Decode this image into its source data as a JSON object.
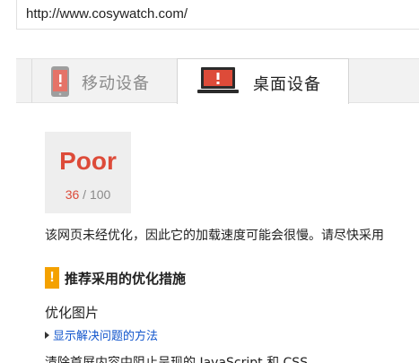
{
  "address_bar": {
    "url": "http://www.cosywatch.com/"
  },
  "tabs": [
    {
      "label": "移动设备",
      "icon": "phone-icon",
      "active": false
    },
    {
      "label": "桌面设备",
      "icon": "laptop-icon",
      "active": true
    }
  ],
  "score": {
    "rating": "Poor",
    "value": "36",
    "separator": " / ",
    "max": "100",
    "color": "#dd4b39"
  },
  "summary": "该网页未经优化，因此它的加载速度可能会很慢。请尽快采用",
  "section": {
    "icon": "warning-icon",
    "icon_glyph": "!",
    "title": "推荐采用的优化措施",
    "icon_color": "#f4a100"
  },
  "rule": {
    "title": "优化图片",
    "show_link": "显示解决问题的方法",
    "next_line_partial": "清除首屏内容中阻止呈现的 JavaScript 和 CSS"
  }
}
